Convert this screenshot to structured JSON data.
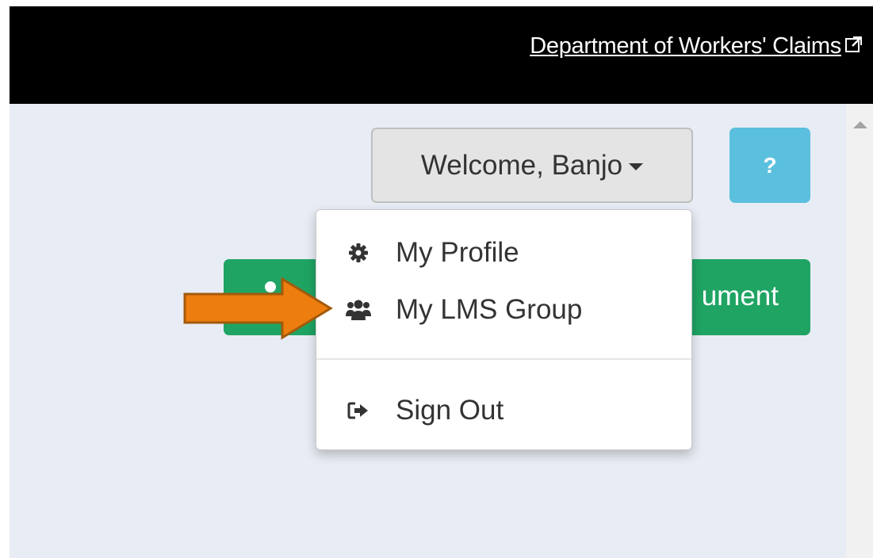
{
  "header": {
    "link_text": "Department of Workers' Claims",
    "link_icon": "external-link-icon"
  },
  "user_menu": {
    "welcome_label": "Welcome, Banjo",
    "caret_icon": "caret-down-icon"
  },
  "help_button": {
    "label": "?"
  },
  "action_button": {
    "visible_label": "ument"
  },
  "dropdown": {
    "items": [
      {
        "label": "My Profile",
        "icon": "gear-icon"
      },
      {
        "label": "My LMS Group",
        "icon": "users-icon"
      },
      {
        "label": "Sign Out",
        "icon": "sign-out-icon"
      }
    ]
  },
  "annotation": {
    "arrow_color": "#ed7d0f",
    "arrow_border": "#a35a0b"
  },
  "colors": {
    "help_button": "#5bc0de",
    "action_button": "#1fa463",
    "top_bar": "#000000",
    "page_bg": "#e8ecf4"
  }
}
